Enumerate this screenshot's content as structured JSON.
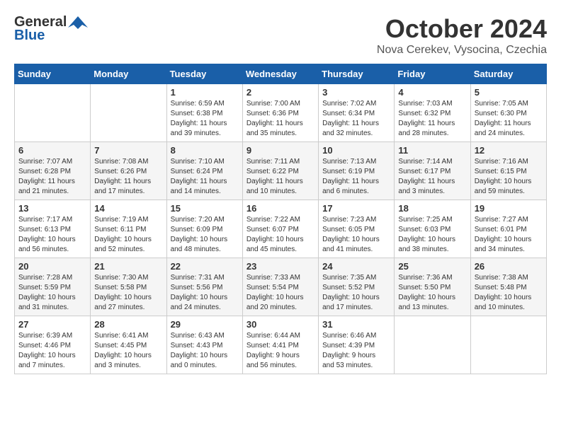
{
  "header": {
    "logo_general": "General",
    "logo_blue": "Blue",
    "month": "October 2024",
    "location": "Nova Cerekev, Vysocina, Czechia"
  },
  "weekdays": [
    "Sunday",
    "Monday",
    "Tuesday",
    "Wednesday",
    "Thursday",
    "Friday",
    "Saturday"
  ],
  "weeks": [
    [
      {
        "day": "",
        "info": ""
      },
      {
        "day": "",
        "info": ""
      },
      {
        "day": "1",
        "info": "Sunrise: 6:59 AM\nSunset: 6:38 PM\nDaylight: 11 hours\nand 39 minutes."
      },
      {
        "day": "2",
        "info": "Sunrise: 7:00 AM\nSunset: 6:36 PM\nDaylight: 11 hours\nand 35 minutes."
      },
      {
        "day": "3",
        "info": "Sunrise: 7:02 AM\nSunset: 6:34 PM\nDaylight: 11 hours\nand 32 minutes."
      },
      {
        "day": "4",
        "info": "Sunrise: 7:03 AM\nSunset: 6:32 PM\nDaylight: 11 hours\nand 28 minutes."
      },
      {
        "day": "5",
        "info": "Sunrise: 7:05 AM\nSunset: 6:30 PM\nDaylight: 11 hours\nand 24 minutes."
      }
    ],
    [
      {
        "day": "6",
        "info": "Sunrise: 7:07 AM\nSunset: 6:28 PM\nDaylight: 11 hours\nand 21 minutes."
      },
      {
        "day": "7",
        "info": "Sunrise: 7:08 AM\nSunset: 6:26 PM\nDaylight: 11 hours\nand 17 minutes."
      },
      {
        "day": "8",
        "info": "Sunrise: 7:10 AM\nSunset: 6:24 PM\nDaylight: 11 hours\nand 14 minutes."
      },
      {
        "day": "9",
        "info": "Sunrise: 7:11 AM\nSunset: 6:22 PM\nDaylight: 11 hours\nand 10 minutes."
      },
      {
        "day": "10",
        "info": "Sunrise: 7:13 AM\nSunset: 6:19 PM\nDaylight: 11 hours\nand 6 minutes."
      },
      {
        "day": "11",
        "info": "Sunrise: 7:14 AM\nSunset: 6:17 PM\nDaylight: 11 hours\nand 3 minutes."
      },
      {
        "day": "12",
        "info": "Sunrise: 7:16 AM\nSunset: 6:15 PM\nDaylight: 10 hours\nand 59 minutes."
      }
    ],
    [
      {
        "day": "13",
        "info": "Sunrise: 7:17 AM\nSunset: 6:13 PM\nDaylight: 10 hours\nand 56 minutes."
      },
      {
        "day": "14",
        "info": "Sunrise: 7:19 AM\nSunset: 6:11 PM\nDaylight: 10 hours\nand 52 minutes."
      },
      {
        "day": "15",
        "info": "Sunrise: 7:20 AM\nSunset: 6:09 PM\nDaylight: 10 hours\nand 48 minutes."
      },
      {
        "day": "16",
        "info": "Sunrise: 7:22 AM\nSunset: 6:07 PM\nDaylight: 10 hours\nand 45 minutes."
      },
      {
        "day": "17",
        "info": "Sunrise: 7:23 AM\nSunset: 6:05 PM\nDaylight: 10 hours\nand 41 minutes."
      },
      {
        "day": "18",
        "info": "Sunrise: 7:25 AM\nSunset: 6:03 PM\nDaylight: 10 hours\nand 38 minutes."
      },
      {
        "day": "19",
        "info": "Sunrise: 7:27 AM\nSunset: 6:01 PM\nDaylight: 10 hours\nand 34 minutes."
      }
    ],
    [
      {
        "day": "20",
        "info": "Sunrise: 7:28 AM\nSunset: 5:59 PM\nDaylight: 10 hours\nand 31 minutes."
      },
      {
        "day": "21",
        "info": "Sunrise: 7:30 AM\nSunset: 5:58 PM\nDaylight: 10 hours\nand 27 minutes."
      },
      {
        "day": "22",
        "info": "Sunrise: 7:31 AM\nSunset: 5:56 PM\nDaylight: 10 hours\nand 24 minutes."
      },
      {
        "day": "23",
        "info": "Sunrise: 7:33 AM\nSunset: 5:54 PM\nDaylight: 10 hours\nand 20 minutes."
      },
      {
        "day": "24",
        "info": "Sunrise: 7:35 AM\nSunset: 5:52 PM\nDaylight: 10 hours\nand 17 minutes."
      },
      {
        "day": "25",
        "info": "Sunrise: 7:36 AM\nSunset: 5:50 PM\nDaylight: 10 hours\nand 13 minutes."
      },
      {
        "day": "26",
        "info": "Sunrise: 7:38 AM\nSunset: 5:48 PM\nDaylight: 10 hours\nand 10 minutes."
      }
    ],
    [
      {
        "day": "27",
        "info": "Sunrise: 6:39 AM\nSunset: 4:46 PM\nDaylight: 10 hours\nand 7 minutes."
      },
      {
        "day": "28",
        "info": "Sunrise: 6:41 AM\nSunset: 4:45 PM\nDaylight: 10 hours\nand 3 minutes."
      },
      {
        "day": "29",
        "info": "Sunrise: 6:43 AM\nSunset: 4:43 PM\nDaylight: 10 hours\nand 0 minutes."
      },
      {
        "day": "30",
        "info": "Sunrise: 6:44 AM\nSunset: 4:41 PM\nDaylight: 9 hours\nand 56 minutes."
      },
      {
        "day": "31",
        "info": "Sunrise: 6:46 AM\nSunset: 4:39 PM\nDaylight: 9 hours\nand 53 minutes."
      },
      {
        "day": "",
        "info": ""
      },
      {
        "day": "",
        "info": ""
      }
    ]
  ]
}
